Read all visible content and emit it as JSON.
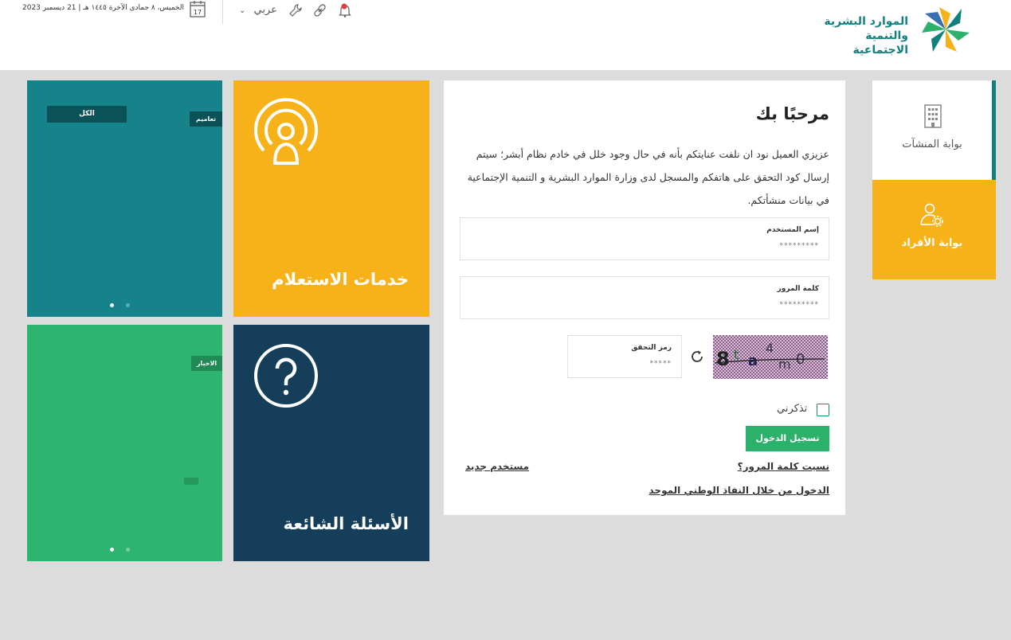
{
  "header": {
    "logo_line1": "الموارد البشرية",
    "logo_line2": "والتنمية الاجتماعية",
    "date": "الخميس، ٨ جمادى الآخرة ١٤٤٥ هـ | 21 ديسمبر 2023",
    "calendar_day": "17",
    "language": "عربي",
    "colors": {
      "brand_teal": "#12807f",
      "brand_yellow": "#f8b219",
      "brand_green": "#2cb16b"
    }
  },
  "sidebar": {
    "establishments": {
      "label": "بوابة المنشآت",
      "icon": "building-icon"
    },
    "individuals": {
      "label": "بوابة الأفراد",
      "icon": "user-gear-icon"
    }
  },
  "login": {
    "welcome": "مرحبًا بك",
    "intro": "عزيزي العميل نود ان نلفت عنايتكم بأنه في حال وجود خلل في خادم نظام أبشر؛ سيتم إرسال كود التحقق على هاتفكم والمسجل لدى وزارة الموارد البشرية و التنمية الإجتماعية في بيانات منشأتكم.",
    "username": {
      "label": "إسم المستخدم",
      "value": "*********"
    },
    "password": {
      "label": "كلمة المرور",
      "value": "*********"
    },
    "captcha": {
      "label": "رمز التحقق",
      "value": "*****"
    },
    "remember_label": "تذكرني",
    "login_button": "تسجيل الدخول",
    "forgot_password": "نسيت كلمة المرور؟",
    "new_user": "مستخدم جديد",
    "national_access": "الدخول من خلال النفاذ الوطني الموحد"
  },
  "tiles": {
    "inquiry": {
      "title": "خدمات الاستعلام",
      "icon": "broadcast-person-icon"
    },
    "faq": {
      "title": "الأسئلة الشائعة",
      "icon": "question-circle-icon"
    },
    "circulars": {
      "tag_all": "الكل",
      "tag_circulars": "تعاميم"
    },
    "news": {
      "tag_news": "الاخبار"
    }
  }
}
